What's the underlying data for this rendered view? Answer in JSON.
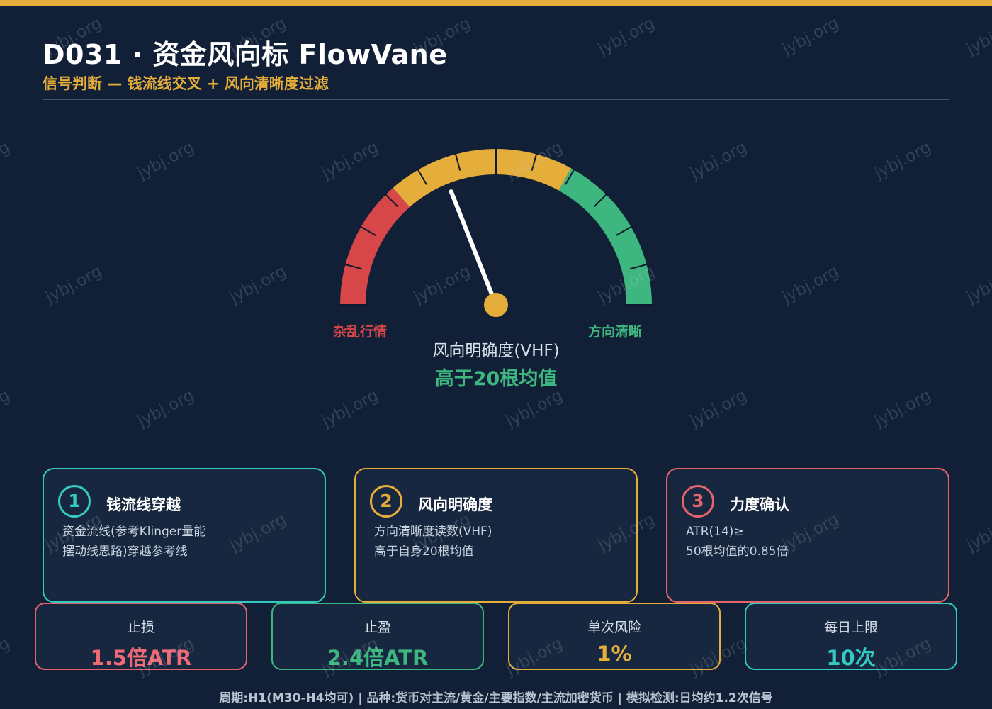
{
  "header": {
    "title": "D031 · 资金风向标 FlowVane",
    "subtitle": "信号判断 — 钱流线交叉 + 风向清晰度过滤"
  },
  "gauge": {
    "left_label": "杂乱行情",
    "right_label": "方向清晰",
    "caption": "风向明确度(VHF)",
    "value_text": "高于20根均值",
    "needle_fraction": 0.38,
    "zones": [
      {
        "name": "red",
        "from": 0.0,
        "to": 0.27,
        "color": "#d7474a"
      },
      {
        "name": "yellow",
        "from": 0.27,
        "to": 0.66,
        "color": "#e5ad3a"
      },
      {
        "name": "green",
        "from": 0.66,
        "to": 1.0,
        "color": "#3db77f"
      }
    ]
  },
  "cards": [
    {
      "num": "1",
      "title": "钱流线穿越",
      "desc_line1": "资金流线(参考Klinger量能",
      "desc_line2": "摆动线思路)穿越参考线"
    },
    {
      "num": "2",
      "title": "风向明确度",
      "desc_line1": "方向清晰度读数(VHF)",
      "desc_line2": "高于自身20根均值"
    },
    {
      "num": "3",
      "title": "力度确认",
      "desc_line1": "ATR(14)≥",
      "desc_line2": "50根均值的0.85倍"
    }
  ],
  "stats": [
    {
      "label": "止损",
      "value": "1.5倍ATR"
    },
    {
      "label": "止盈",
      "value": "2.4倍ATR"
    },
    {
      "label": "单次风险",
      "value": "1%"
    },
    {
      "label": "每日上限",
      "value": "10次"
    }
  ],
  "footer": "周期:H1(M30-H4均可) | 品种:货币对主流/黄金/主要指数/主流加密货币 | 模拟检测:日均约1.2次信号",
  "watermark": "jybj.org",
  "colors": {
    "accent": "#e5ad3a",
    "background": "#112036",
    "teal": "#34c9c1",
    "red": "#e4646b",
    "green": "#3db77f"
  }
}
